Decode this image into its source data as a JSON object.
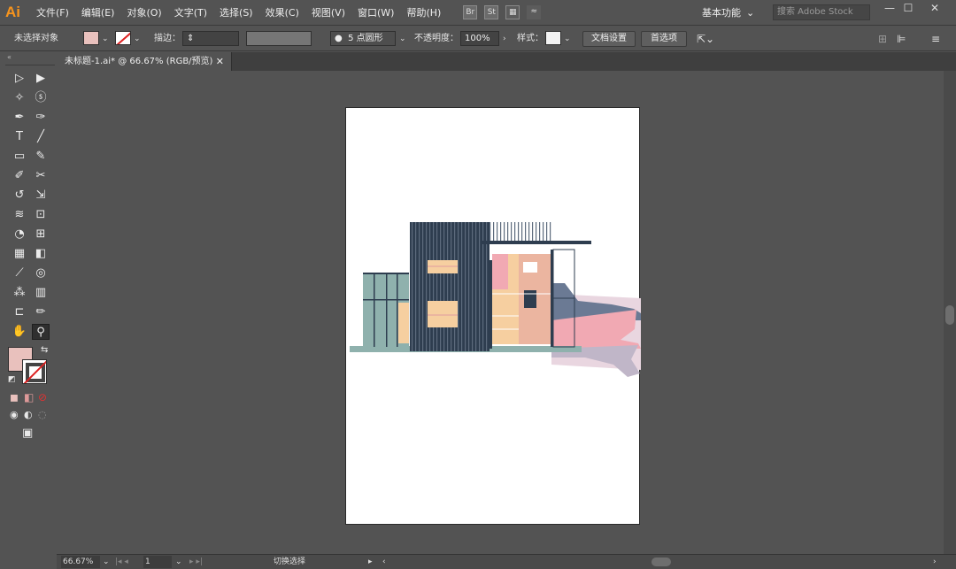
{
  "app": {
    "logo": "Ai"
  },
  "menu": [
    "文件(F)",
    "编辑(E)",
    "对象(O)",
    "文字(T)",
    "选择(S)",
    "效果(C)",
    "视图(V)",
    "窗口(W)",
    "帮助(H)"
  ],
  "menu_icons": {
    "br": "Br",
    "st": "St"
  },
  "workspace": {
    "label": "基本功能",
    "chevron": "⌄"
  },
  "search": {
    "placeholder": "搜索 Adobe Stock"
  },
  "window_controls": {
    "minimize": "—",
    "maximize": "☐",
    "close": "✕"
  },
  "control_bar": {
    "no_selection": "未选择对象",
    "fill_color": "#e9c1bd",
    "stroke_label": "描边：",
    "brush_value": "5 点圆形",
    "opacity_label": "不透明度：",
    "opacity_value": "100%",
    "style_label": "样式：",
    "doc_setup": "文档设置",
    "preferences": "首选项"
  },
  "document_tab": {
    "title": "未标题-1.ai* @ 66.67% (RGB/预览)",
    "close": "✕"
  },
  "toolbox": {
    "collapse": "«",
    "tools": [
      {
        "name": "selection-tool",
        "glyph": "▷"
      },
      {
        "name": "direct-selection-tool",
        "glyph": "▶"
      },
      {
        "name": "magic-wand-tool",
        "glyph": "✧"
      },
      {
        "name": "lasso-tool",
        "glyph": "ⓢ"
      },
      {
        "name": "pen-tool",
        "glyph": "✒"
      },
      {
        "name": "curvature-tool",
        "glyph": "✑"
      },
      {
        "name": "type-tool",
        "glyph": "T"
      },
      {
        "name": "line-tool",
        "glyph": "╱"
      },
      {
        "name": "rectangle-tool",
        "glyph": "▭"
      },
      {
        "name": "paintbrush-tool",
        "glyph": "✎"
      },
      {
        "name": "shaper-tool",
        "glyph": "✐"
      },
      {
        "name": "scissors-tool",
        "glyph": "✂"
      },
      {
        "name": "rotate-tool",
        "glyph": "↺"
      },
      {
        "name": "scale-tool",
        "glyph": "⇲"
      },
      {
        "name": "warp-tool",
        "glyph": "≋"
      },
      {
        "name": "free-transform-tool",
        "glyph": "⊡"
      },
      {
        "name": "shape-builder-tool",
        "glyph": "◔"
      },
      {
        "name": "perspective-grid-tool",
        "glyph": "⊞"
      },
      {
        "name": "mesh-tool",
        "glyph": "▦"
      },
      {
        "name": "gradient-tool",
        "glyph": "◧"
      },
      {
        "name": "eyedropper-tool",
        "glyph": "⟋"
      },
      {
        "name": "blend-tool",
        "glyph": "◎"
      },
      {
        "name": "symbol-sprayer-tool",
        "glyph": "⁂"
      },
      {
        "name": "column-graph-tool",
        "glyph": "▥"
      },
      {
        "name": "artboard-tool",
        "glyph": "⊏"
      },
      {
        "name": "slice-tool",
        "glyph": "✏"
      },
      {
        "name": "hand-tool",
        "glyph": "✋"
      },
      {
        "name": "zoom-tool",
        "glyph": "⚲"
      }
    ],
    "fill_color": "#e9c1bd",
    "swap": "⇆",
    "default": "◩",
    "mode_color": "◼",
    "mode_gradient": "◧",
    "mode_none": "⊘",
    "draw_normal": "◉",
    "draw_behind": "◐",
    "draw_inside": "◌",
    "screen_mode": "▣"
  },
  "status_bar": {
    "zoom": "66.67%",
    "page": "1",
    "mode": "切换选择"
  },
  "artwork": {
    "dark": "#2e3d4f",
    "glass": "#8fb1ad",
    "window_warm": "#f6cfa0",
    "salmon": "#ebb5a0",
    "pink": "#f1a9b3",
    "haze": "#c0b6c8",
    "slate": "#6b7a94",
    "sky": "#e9d6e0"
  }
}
